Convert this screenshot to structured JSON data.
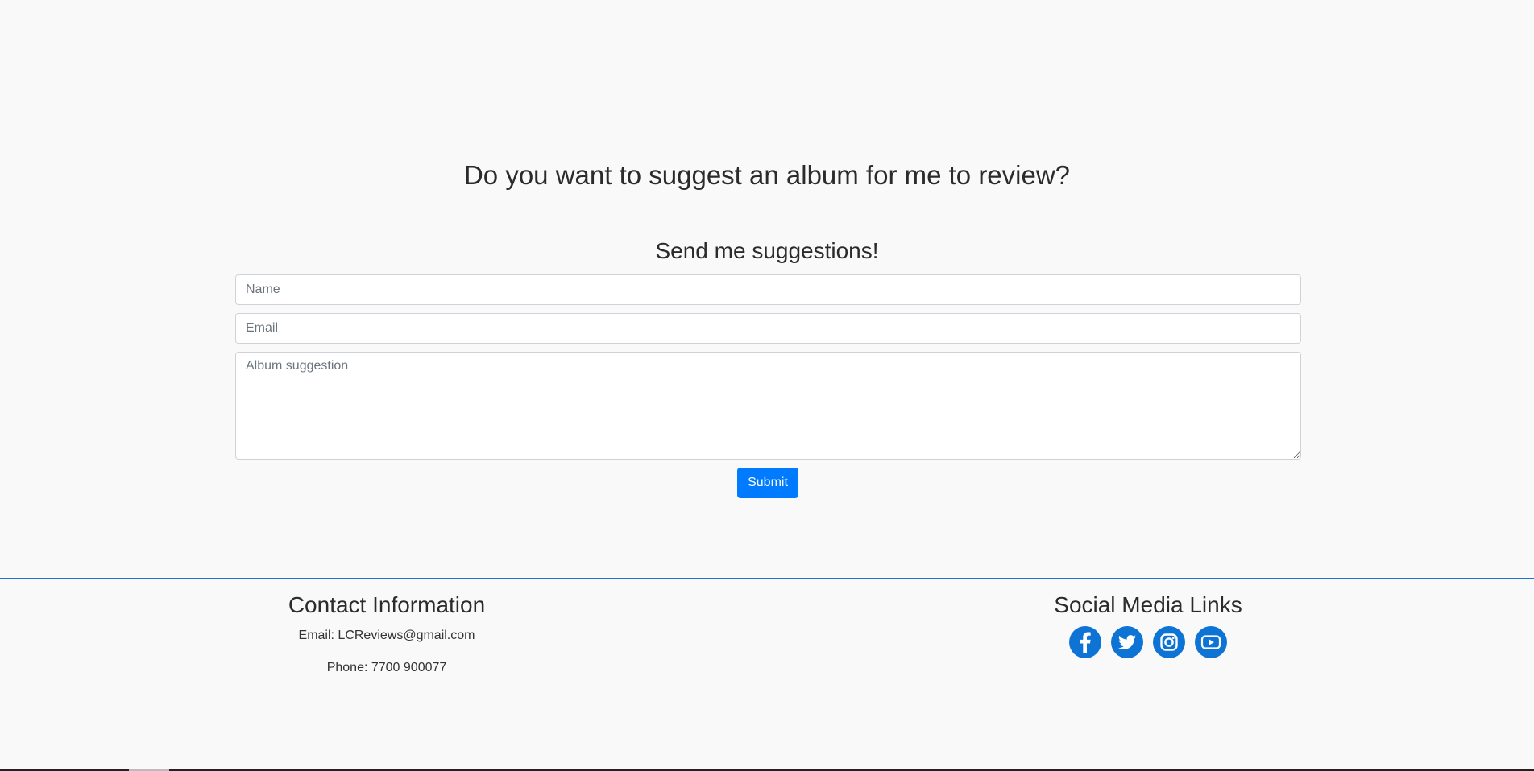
{
  "main": {
    "heading": "Do you want to suggest an album for me to review?",
    "form_title": "Send me suggestions!",
    "name_placeholder": "Name",
    "email_placeholder": "Email",
    "album_placeholder": "Album suggestion",
    "submit_label": "Submit"
  },
  "footer": {
    "contact_heading": "Contact Information",
    "contact_email": "Email: LCReviews@gmail.com",
    "contact_phone": "Phone: 7700 900077",
    "social_heading": "Social Media Links",
    "social_icons": [
      "facebook-icon",
      "twitter-icon",
      "instagram-icon",
      "youtube-icon"
    ]
  },
  "colors": {
    "accent": "#007bff",
    "footer_border": "#1b74d6",
    "social_icon": "#0d74d6",
    "background": "#f9f9f9"
  }
}
